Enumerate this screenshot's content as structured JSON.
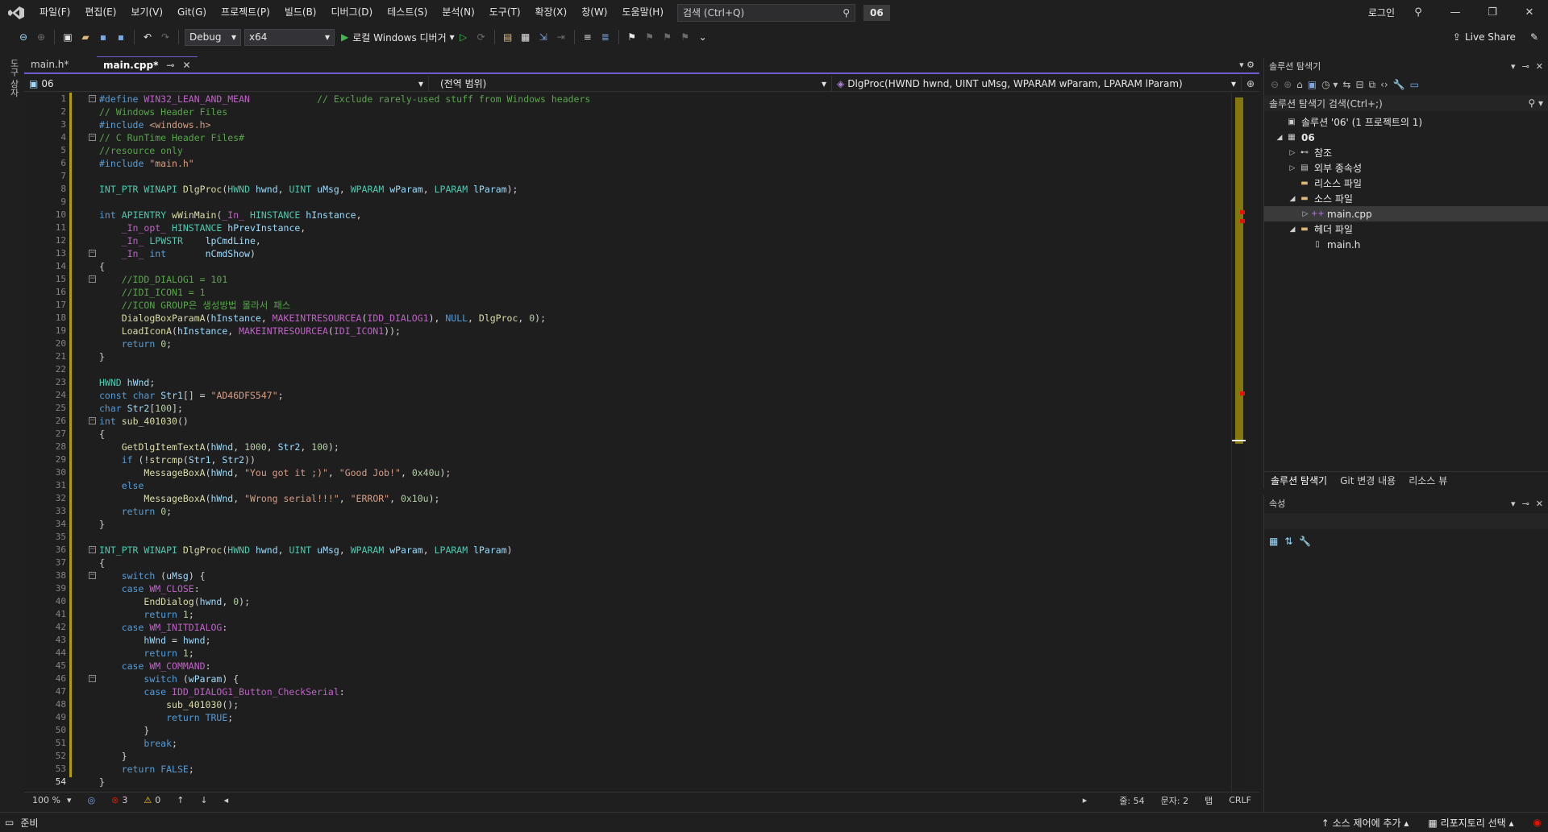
{
  "menu": {
    "items": [
      "파일(F)",
      "편집(E)",
      "보기(V)",
      "Git(G)",
      "프로젝트(P)",
      "빌드(B)",
      "디버그(D)",
      "테스트(S)",
      "분석(N)",
      "도구(T)",
      "확장(X)",
      "창(W)",
      "도움말(H)"
    ],
    "search_placeholder": "검색 (Ctrl+Q)",
    "project_badge": "06",
    "login": "로그인"
  },
  "toolbar": {
    "config": "Debug",
    "platform": "x64",
    "run_label": "로컬 Windows 디버거",
    "live_share": "Live Share"
  },
  "left_strip": {
    "label": "도구 상자"
  },
  "tabs": [
    {
      "label": "main.h*",
      "active": false
    },
    {
      "label": "main.cpp*",
      "active": true
    }
  ],
  "navbar": {
    "project": "06",
    "scope": "(전역 범위)",
    "member": "DlgProc(HWND hwnd, UINT uMsg, WPARAM wParam, LPARAM lParam)"
  },
  "code": {
    "lines": [
      "#define WIN32_LEAN_AND_MEAN            // Exclude rarely-used stuff from Windows headers",
      "// Windows Header Files",
      "#include <windows.h>",
      "// C RunTime Header Files#",
      "//resource only",
      "#include \"main.h\"",
      "",
      "INT_PTR WINAPI DlgProc(HWND hwnd, UINT uMsg, WPARAM wParam, LPARAM lParam);",
      "",
      "int APIENTRY wWinMain(_In_ HINSTANCE hInstance,",
      "    _In_opt_ HINSTANCE hPrevInstance,",
      "    _In_ LPWSTR    lpCmdLine,",
      "    _In_ int       nCmdShow)",
      "{",
      "    //IDD_DIALOG1 = 101",
      "    //IDI_ICON1 = 1",
      "    //ICON GROUP은 생성방법 몰라서 패스",
      "    DialogBoxParamA(hInstance, MAKEINTRESOURCEA(IDD_DIALOG1), NULL, DlgProc, 0);",
      "    LoadIconA(hInstance, MAKEINTRESOURCEA(IDI_ICON1));",
      "    return 0;",
      "}",
      "",
      "HWND hWnd;",
      "const char Str1[] = \"AD46DFS547\";",
      "char Str2[100];",
      "int sub_401030()",
      "{",
      "    GetDlgItemTextA(hWnd, 1000, Str2, 100);",
      "    if (!strcmp(Str1, Str2))",
      "        MessageBoxA(hWnd, \"You got it ;)\", \"Good Job!\", 0x40u);",
      "    else",
      "        MessageBoxA(hWnd, \"Wrong serial!!!\", \"ERROR\", 0x10u);",
      "    return 0;",
      "}",
      "",
      "INT_PTR WINAPI DlgProc(HWND hwnd, UINT uMsg, WPARAM wParam, LPARAM lParam)",
      "{",
      "    switch (uMsg) {",
      "    case WM_CLOSE:",
      "        EndDialog(hwnd, 0);",
      "        return 1;",
      "    case WM_INITDIALOG:",
      "        hWnd = hwnd;",
      "        return 1;",
      "    case WM_COMMAND:",
      "        switch (wParam) {",
      "        case IDD_DIALOG1_Button_CheckSerial:",
      "            sub_401030();",
      "            return TRUE;",
      "        }",
      "        break;",
      "    }",
      "    return FALSE;",
      "}"
    ],
    "current_line": 54
  },
  "editor_status": {
    "zoom": "100 %",
    "errors": "3",
    "warnings": "0",
    "line": "줄: 54",
    "char": "문자: 2",
    "indent": "탭",
    "eol": "CRLF"
  },
  "solution_explorer": {
    "title": "솔루션 탐색기",
    "search_placeholder": "솔루션 탐색기 검색(Ctrl+;)",
    "tree": [
      {
        "label": "솔루션 '06' (1 프로젝트의 1)",
        "depth": 0,
        "arrow": "",
        "icon": "solution-icon",
        "glyph": "▣",
        "selected": false,
        "bold": false
      },
      {
        "label": "06",
        "depth": 0,
        "arrow": "◢",
        "icon": "project-icon",
        "glyph": "▦",
        "selected": false,
        "bold": true
      },
      {
        "label": "참조",
        "depth": 1,
        "arrow": "▷",
        "icon": "references-icon",
        "glyph": "⊷",
        "selected": false,
        "bold": false
      },
      {
        "label": "외부 종속성",
        "depth": 1,
        "arrow": "▷",
        "icon": "external-deps-icon",
        "glyph": "▤",
        "selected": false,
        "bold": false
      },
      {
        "label": "리소스 파일",
        "depth": 1,
        "arrow": "",
        "icon": "folder-icon",
        "glyph": "▬",
        "selected": false,
        "bold": false
      },
      {
        "label": "소스 파일",
        "depth": 1,
        "arrow": "◢",
        "icon": "folder-open-icon",
        "glyph": "▬",
        "selected": false,
        "bold": false
      },
      {
        "label": "main.cpp",
        "depth": 2,
        "arrow": "▷",
        "icon": "cpp-file-icon",
        "glyph": "++",
        "selected": true,
        "bold": false
      },
      {
        "label": "헤더 파일",
        "depth": 1,
        "arrow": "◢",
        "icon": "folder-open-icon",
        "glyph": "▬",
        "selected": false,
        "bold": false
      },
      {
        "label": "main.h",
        "depth": 2,
        "arrow": "",
        "icon": "header-file-icon",
        "glyph": "▯",
        "selected": false,
        "bold": false
      }
    ],
    "bottom_tabs": [
      "솔루션 탐색기",
      "Git 변경 내용",
      "리소스 뷰"
    ]
  },
  "properties": {
    "title": "속성"
  },
  "statusbar": {
    "ready": "준비",
    "add_source_control": "소스 제어에 추가",
    "select_repo": "리포지토리 선택"
  },
  "colors": {
    "accent": "#6c5ed1",
    "keyword": "#569cd6",
    "type": "#4ec9b0",
    "function": "#dcdcaa",
    "string": "#d69d85",
    "comment": "#57a64a",
    "macro": "#bd63c5",
    "number": "#b5cea8",
    "change_bar": "#c8b400",
    "error": "#e51400"
  }
}
